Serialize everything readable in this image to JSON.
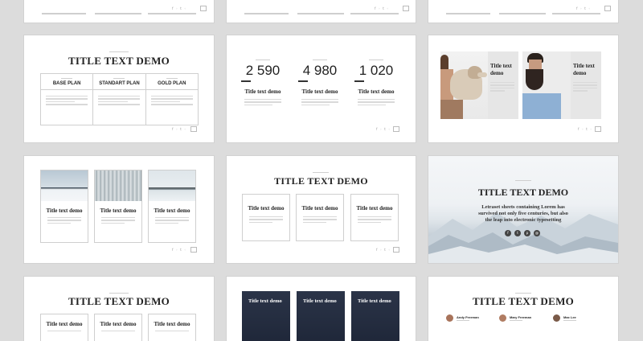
{
  "slides": {
    "plans": {
      "title": "TITLE TEXT DEMO",
      "plans": [
        "BASE PLAN",
        "STANDART PLAN",
        "GOLD PLAN"
      ]
    },
    "stats": {
      "numbers": [
        "2 590",
        "4 980",
        "1 020"
      ],
      "labels": [
        "Title text demo",
        "Title text demo",
        "Title text demo"
      ]
    },
    "photos": {
      "labels": [
        "Title text demo",
        "Title text demo"
      ]
    },
    "cards": {
      "labels": [
        "Title text demo",
        "Title text demo",
        "Title text demo"
      ]
    },
    "boxes": {
      "title": "TITLE TEXT DEMO",
      "labels": [
        "Title text demo",
        "Title text demo",
        "Title text demo"
      ]
    },
    "hero": {
      "title": "TITLE TEXT DEMO",
      "text_line1": "Letraset sheets containing Lorem has",
      "text_line2": "survived not only five centuries, but also",
      "text_line3": "the leap into electronic typesetting"
    },
    "bottom_left": {
      "title": "TITLE TEXT DEMO",
      "labels": [
        "Title text demo",
        "Title text demo",
        "Title text demo"
      ]
    },
    "bottom_mid": {
      "labels": [
        "Title text demo",
        "Title text demo",
        "Title text demo"
      ]
    },
    "team": {
      "title": "TITLE TEXT DEMO",
      "people": [
        "Andy Freeman",
        "Mary Freeman",
        "Max Lee"
      ]
    }
  }
}
